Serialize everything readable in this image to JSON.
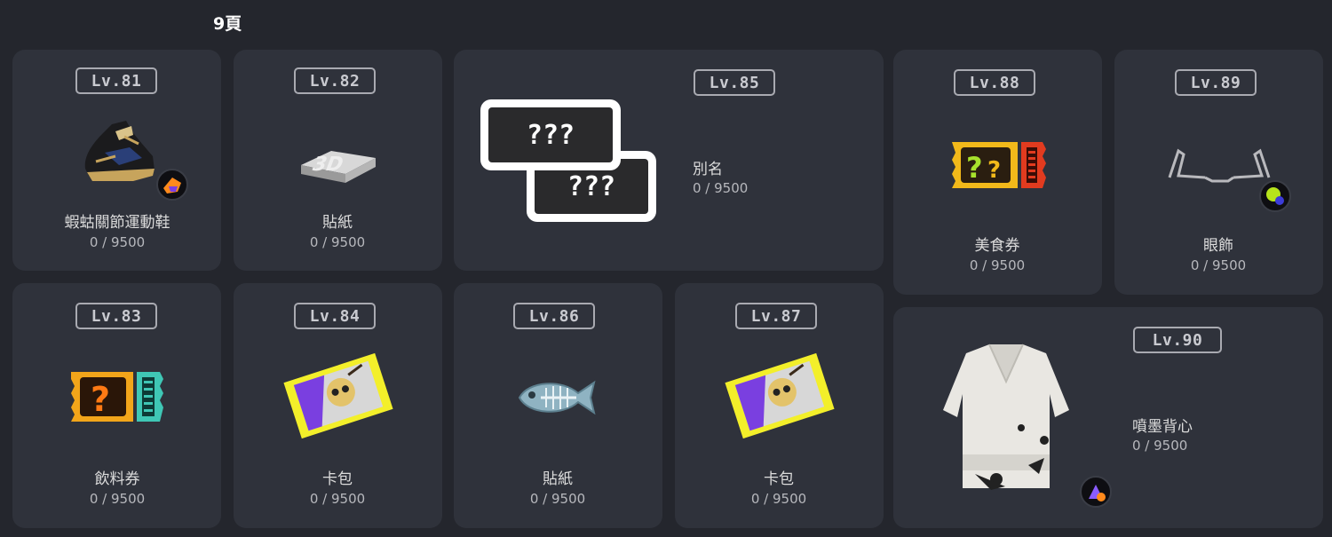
{
  "page": {
    "title": "9頁"
  },
  "rewards": [
    {
      "level": "Lv.81",
      "name": "蝦蛄關節運動鞋",
      "progress": "0 / 9500",
      "icon": "sneaker-icon",
      "badge": "ability-badge-icon"
    },
    {
      "level": "Lv.82",
      "name": "貼紙",
      "progress": "0 / 9500",
      "icon": "sticker-3d-icon"
    },
    {
      "level": "Lv.85",
      "name": "別名",
      "progress": "0 / 9500",
      "icon": "title-tag-icon",
      "tag_text": "???"
    },
    {
      "level": "Lv.88",
      "name": "美食券",
      "progress": "0 / 9500",
      "icon": "food-ticket-icon"
    },
    {
      "level": "Lv.89",
      "name": "眼飾",
      "progress": "0 / 9500",
      "icon": "glasses-icon",
      "badge": "ability-badge-icon"
    },
    {
      "level": "Lv.83",
      "name": "飲料券",
      "progress": "0 / 9500",
      "icon": "drink-ticket-icon"
    },
    {
      "level": "Lv.84",
      "name": "卡包",
      "progress": "0 / 9500",
      "icon": "card-pack-icon"
    },
    {
      "level": "Lv.86",
      "name": "貼紙",
      "progress": "0 / 9500",
      "icon": "fish-bone-sticker-icon"
    },
    {
      "level": "Lv.87",
      "name": "卡包",
      "progress": "0 / 9500",
      "icon": "card-pack-icon"
    },
    {
      "level": "Lv.90",
      "name": "噴墨背心",
      "progress": "0 / 9500",
      "icon": "vest-icon",
      "badge": "ability-badge-icon"
    }
  ],
  "colors": {
    "background": "#24262d",
    "card": "#2f323b",
    "level_border": "#a9aab1"
  }
}
